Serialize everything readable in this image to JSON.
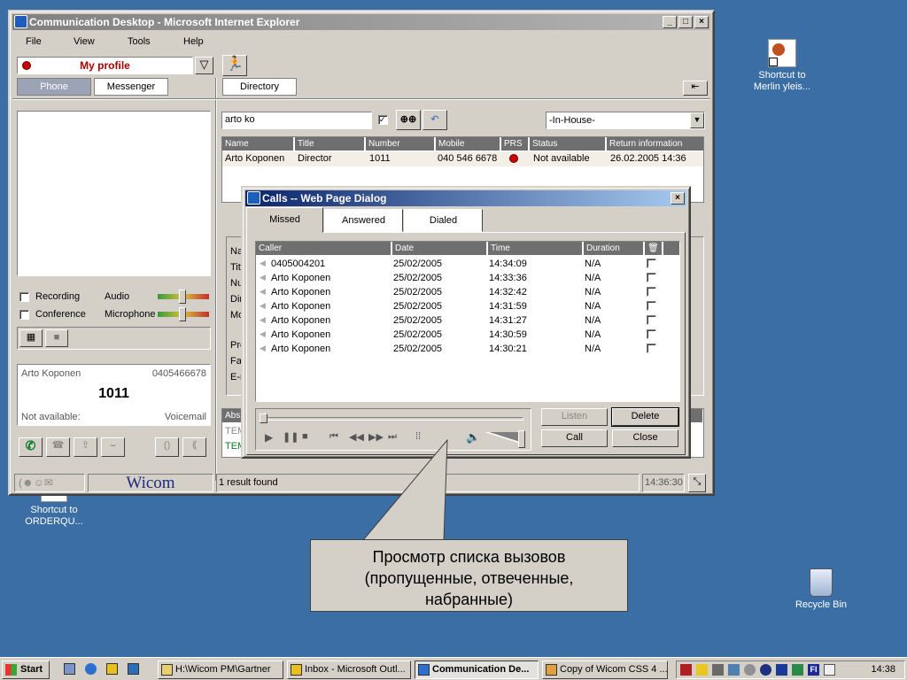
{
  "desktop": {
    "icons": [
      {
        "label1": "Shortcut to",
        "label2": "Merlin yleis..."
      },
      {
        "label1": "Shortcut to",
        "label2": "ORDERQU..."
      },
      {
        "label1": "Recycle Bin",
        "label2": ""
      }
    ]
  },
  "window": {
    "title": "Communication Desktop - Microsoft Internet Explorer",
    "menu": [
      "File",
      "View",
      "Tools",
      "Help"
    ],
    "profile_label": "My profile",
    "tabs": {
      "phone": "Phone",
      "messenger": "Messenger",
      "directory": "Directory"
    },
    "options": {
      "recording": "Recording",
      "conference": "Conference",
      "audio": "Audio",
      "microphone": "Microphone"
    },
    "current_call": {
      "name": "Arto Koponen",
      "number": "0405466678",
      "extension": "1011",
      "status": "Not available:",
      "voicemail": "Voicemail"
    },
    "search": {
      "value": "arto ko",
      "filter": "-In-House-"
    },
    "directory_headers": [
      "Name",
      "Title",
      "Number",
      "Mobile",
      "PRS",
      "Status",
      "Return information"
    ],
    "directory_rows": [
      {
        "name": "Arto Koponen",
        "title": "Director",
        "number": "1011",
        "mobile": "040 546 6678",
        "status": "Not available",
        "return": "26.02.2005 14:36"
      }
    ],
    "details_labels": [
      "Na",
      "Titl",
      "Nu",
      "Dir",
      "Mo",
      "Pro",
      "Fa",
      "E-m"
    ],
    "lower_labels": [
      "Abs",
      "TEM",
      "TEM"
    ],
    "status_logo": "Wicom",
    "status_text": "1 result found",
    "status_time": "14:36:30"
  },
  "dialog": {
    "title": "Calls -- Web Page Dialog",
    "tabs": [
      "Missed",
      "Answered",
      "Dialed"
    ],
    "headers": [
      "Caller",
      "Date",
      "Time",
      "Duration"
    ],
    "rows": [
      {
        "caller": "0405004201",
        "date": "25/02/2005",
        "time": "14:34:09",
        "duration": "N/A"
      },
      {
        "caller": "Arto Koponen",
        "date": "25/02/2005",
        "time": "14:33:36",
        "duration": "N/A"
      },
      {
        "caller": "Arto Koponen",
        "date": "25/02/2005",
        "time": "14:32:42",
        "duration": "N/A"
      },
      {
        "caller": "Arto Koponen",
        "date": "25/02/2005",
        "time": "14:31:59",
        "duration": "N/A"
      },
      {
        "caller": "Arto Koponen",
        "date": "25/02/2005",
        "time": "14:31:27",
        "duration": "N/A"
      },
      {
        "caller": "Arto Koponen",
        "date": "25/02/2005",
        "time": "14:30:59",
        "duration": "N/A"
      },
      {
        "caller": "Arto Koponen",
        "date": "25/02/2005",
        "time": "14:30:21",
        "duration": "N/A"
      }
    ],
    "buttons": {
      "listen": "Listen",
      "delete": "Delete",
      "call": "Call",
      "close": "Close"
    }
  },
  "callout": {
    "line1": "Просмотр списка вызовов",
    "line2": "(пропущенные, отвеченные,",
    "line3": "набранные)"
  },
  "taskbar": {
    "start": "Start",
    "tasks": [
      "H:\\Wicom PM\\Gartner",
      "Inbox - Microsoft Outl...",
      "Communication De...",
      "Copy of Wicom CSS 4 ..."
    ],
    "lang": "FI",
    "clock": "14:38"
  },
  "colors": {
    "desktop": "#3a6ea5",
    "dialog_title": "#0a246a",
    "presence_red": "#cc0000",
    "green_icon": "#0a7a2a"
  }
}
